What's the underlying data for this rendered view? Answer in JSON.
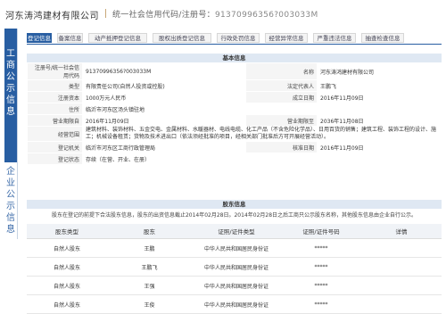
{
  "header": {
    "company_name": "河东涛鸿建材有限公司",
    "uscc_label": "统一社会信用代码/注册号：",
    "uscc_value": "91370996356?003033M"
  },
  "sidebar": {
    "section1_label": "工商公示信息",
    "section2_label": "企业公示信息"
  },
  "tabs": [
    "登记信息",
    "备案信息",
    "动产抵押登记信息",
    "股权出质登记信息",
    "行政处罚信息",
    "经营异常信息",
    "严重违法信息",
    "抽查检查信息"
  ],
  "basic_info": {
    "title": "基本信息",
    "rows": [
      {
        "l1": "注册号/统一社会信用代码",
        "v1": "91370996356?003033M",
        "l2": "名称",
        "v2": "河东涛鸿建材有限公司"
      },
      {
        "l1": "类型",
        "v1": "有限责任公司(自然人投资或控股)",
        "l2": "法定代表人",
        "v2": "王鹏飞"
      },
      {
        "l1": "注册资本",
        "v1": "1000万元人民币",
        "l2": "成立日期",
        "v2": "2016年11月09日"
      },
      {
        "l1": "住所",
        "v1": "临沂市河东区汤头镇驻地",
        "l2": "",
        "v2": ""
      },
      {
        "l1": "营业期限自",
        "v1": "2016年11月09日",
        "l2": "营业期限至",
        "v2": "2036年11月08日"
      },
      {
        "l1": "经营范围",
        "v1": "建筑材料、装饰材料、五金交电、金属材料、水暖器材、电线电缆、化工产品（不含危险化学品）、日用百货的销售；建筑工程、装饰工程的设计、施工；机械设备租赁；货物及技术进出口（依法须经批准的项目，经相关部门批准后方可开展经营活动）。",
        "l2": "",
        "v2": ""
      },
      {
        "l1": "登记机关",
        "v1": "临沂市河东区工商行政管理局",
        "l2": "核准日期",
        "v2": "2016年11月09日"
      },
      {
        "l1": "登记状态",
        "v1": "存续（在营、开业、在册）",
        "l2": "",
        "v2": ""
      }
    ]
  },
  "partners": {
    "title": "股东信息",
    "note": "股东在登记的前提下合法股东信息，股东的出资信息截止2014年02月28日。2014年02月28日之后工商只公示股东名称，其他股东信息由企业自行公示。",
    "columns": [
      "股东类型",
      "股东",
      "证照/证件类型",
      "证照/证件号码",
      "详情"
    ],
    "rows": [
      {
        "type": "自然人股东",
        "name": "王鹏",
        "id_type": "中华人民共和国居民身份证",
        "id_no": "*****",
        "detail": ""
      },
      {
        "type": "自然人股东",
        "name": "王鹏飞",
        "id_type": "中华人民共和国居民身份证",
        "id_no": "*****",
        "detail": ""
      },
      {
        "type": "自然人股东",
        "name": "王强",
        "id_type": "中华人民共和国居民身份证",
        "id_no": "*****",
        "detail": ""
      },
      {
        "type": "自然人股东",
        "name": "王俊",
        "id_type": "中华人民共和国居民身份证",
        "id_no": "*****",
        "detail": ""
      }
    ]
  },
  "colors": {
    "accent": "#285ea2",
    "section_header_bg": "#dfe8f3",
    "label_bg": "#f5f5f5",
    "separator": "#c9a878"
  }
}
